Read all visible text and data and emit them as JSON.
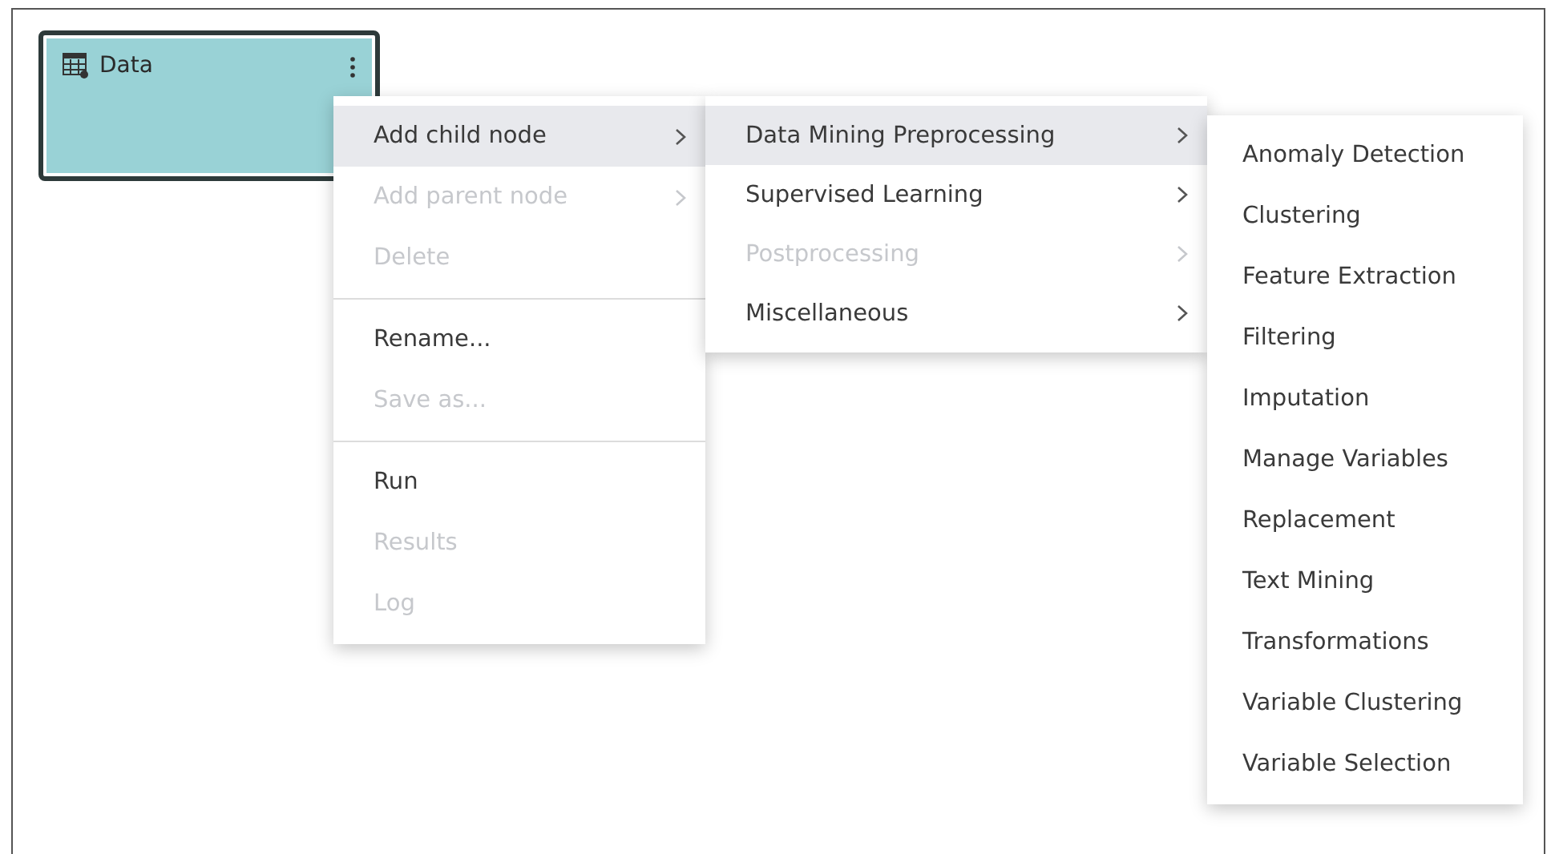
{
  "node": {
    "title": "Data",
    "selected": true
  },
  "context_menu": {
    "groups": [
      [
        {
          "label": "Add child node",
          "kind": "submenu",
          "disabled": false,
          "selected": true
        },
        {
          "label": "Add parent node",
          "kind": "submenu",
          "disabled": true,
          "selected": false
        },
        {
          "label": "Delete",
          "kind": "action",
          "disabled": true,
          "selected": false
        }
      ],
      [
        {
          "label": "Rename...",
          "kind": "action",
          "disabled": false,
          "selected": false
        },
        {
          "label": "Save as...",
          "kind": "action",
          "disabled": true,
          "selected": false
        }
      ],
      [
        {
          "label": "Run",
          "kind": "action",
          "disabled": false,
          "selected": false
        },
        {
          "label": "Results",
          "kind": "action",
          "disabled": true,
          "selected": false
        },
        {
          "label": "Log",
          "kind": "action",
          "disabled": true,
          "selected": false
        }
      ]
    ]
  },
  "submenu": {
    "items": [
      {
        "label": "Data Mining Preprocessing",
        "kind": "submenu",
        "disabled": false,
        "selected": true
      },
      {
        "label": "Supervised Learning",
        "kind": "submenu",
        "disabled": false,
        "selected": false
      },
      {
        "label": "Postprocessing",
        "kind": "submenu",
        "disabled": true,
        "selected": false
      },
      {
        "label": "Miscellaneous",
        "kind": "submenu",
        "disabled": false,
        "selected": false
      }
    ]
  },
  "sub_submenu": {
    "items": [
      {
        "label": "Anomaly Detection",
        "kind": "action",
        "disabled": false,
        "selected": false
      },
      {
        "label": "Clustering",
        "kind": "action",
        "disabled": false,
        "selected": false
      },
      {
        "label": "Feature Extraction",
        "kind": "action",
        "disabled": false,
        "selected": false
      },
      {
        "label": "Filtering",
        "kind": "action",
        "disabled": false,
        "selected": false
      },
      {
        "label": "Imputation",
        "kind": "action",
        "disabled": false,
        "selected": false
      },
      {
        "label": "Manage Variables",
        "kind": "action",
        "disabled": false,
        "selected": false
      },
      {
        "label": "Replacement",
        "kind": "action",
        "disabled": false,
        "selected": false
      },
      {
        "label": "Text Mining",
        "kind": "action",
        "disabled": false,
        "selected": false
      },
      {
        "label": "Transformations",
        "kind": "action",
        "disabled": false,
        "selected": false
      },
      {
        "label": "Variable Clustering",
        "kind": "action",
        "disabled": false,
        "selected": false
      },
      {
        "label": "Variable Selection",
        "kind": "action",
        "disabled": false,
        "selected": false
      }
    ]
  }
}
